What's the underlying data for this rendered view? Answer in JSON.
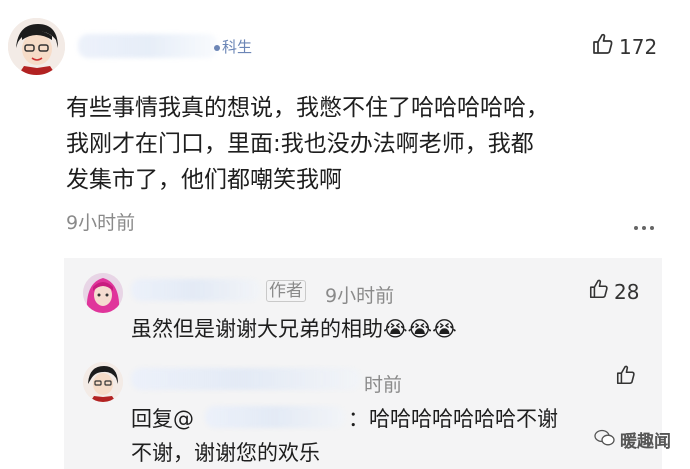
{
  "comment": {
    "badge_text": "科生",
    "like_count": "172",
    "text_lines": [
      "有些事情我真的想说，我憋不住了哈哈哈哈哈，",
      "我刚才在门口，里面:我也没办法啊老师，我都",
      "发集市了，他们都嘲笑我啊"
    ],
    "time": "9小时前"
  },
  "replies": [
    {
      "author_tag": "作者",
      "time": "9小时前",
      "like_count": "28",
      "text": "虽然但是谢谢大兄弟的相助",
      "emoji": [
        "😭",
        "😭",
        "😭"
      ]
    },
    {
      "time_partial": "时前",
      "reply_prefix": "回复@",
      "text_line1": "哈哈哈哈哈哈哈不谢",
      "text_line2": "不谢，谢谢您的欢乐"
    }
  ],
  "watermark": {
    "text": "暖趣闻"
  }
}
